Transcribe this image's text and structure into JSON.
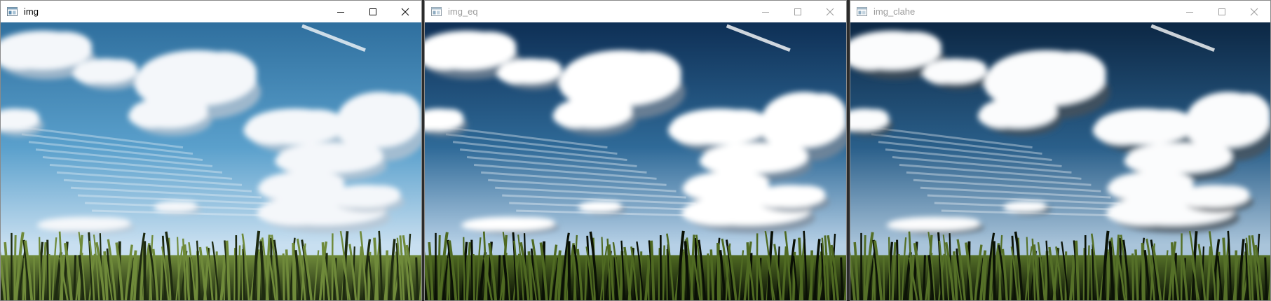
{
  "windows": [
    {
      "title": "img",
      "active": true,
      "image": "sky-clouds-cornfield-original",
      "tone": {
        "sky_top": "#2f6f9e",
        "sky_mid": "#5aa0cc",
        "sky_low": "#c8dff0",
        "cloud": "#f4f7fa",
        "cloud_shade": "#b9c6d2",
        "field_top": "#6f8a3a",
        "field_bottom": "#1e2a10"
      }
    },
    {
      "title": "img_eq",
      "active": false,
      "image": "sky-clouds-cornfield-equalized",
      "tone": {
        "sky_top": "#0e2f55",
        "sky_mid": "#2f6a98",
        "sky_low": "#b6d0e6",
        "cloud": "#ffffff",
        "cloud_shade": "#7d8b99",
        "field_top": "#4f6a22",
        "field_bottom": "#0a1005"
      }
    },
    {
      "title": "img_clahe",
      "active": false,
      "image": "sky-clouds-cornfield-clahe",
      "tone": {
        "sky_top": "#0c2744",
        "sky_mid": "#2a5f8a",
        "sky_low": "#a9c4da",
        "cloud": "#fbfcfd",
        "cloud_shade": "#4a5258",
        "field_top": "#557028",
        "field_bottom": "#0c1306"
      }
    }
  ],
  "icons": {
    "app": "opencv-window-icon",
    "minimize": "minimize-icon",
    "maximize": "maximize-icon",
    "close": "close-icon"
  }
}
